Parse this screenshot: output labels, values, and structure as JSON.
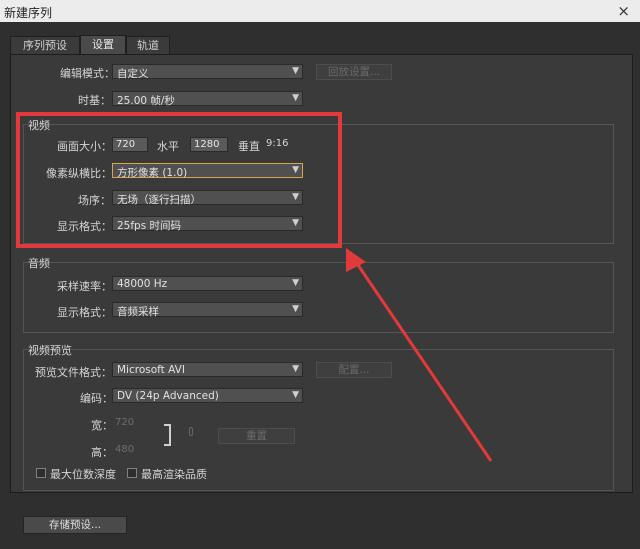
{
  "window": {
    "title": "新建序列",
    "close": "×"
  },
  "tabs": [
    {
      "label": "序列预设"
    },
    {
      "label": "设置"
    },
    {
      "label": "轨道"
    }
  ],
  "edit_mode": {
    "label": "编辑模式：",
    "value": "自定义",
    "button": "回放设置..."
  },
  "timebase": {
    "label": "时基：",
    "value": "25.00 帧/秒"
  },
  "video": {
    "title": "视频",
    "frame_size_label": "画面大小：",
    "width_value": "720",
    "horizontal_label": "水平",
    "height_value": "1280",
    "vertical_label": "垂直",
    "aspect": "9:16",
    "pixel_aspect": {
      "label": "像素纵横比：",
      "value": "方形像素 (1.0)"
    },
    "field": {
      "label": "场序：",
      "value": "无场（逐行扫描）"
    },
    "display_format": {
      "label": "显示格式：",
      "value": "25fps 时间码"
    }
  },
  "audio": {
    "title": "音频",
    "sample_rate": {
      "label": "采样速率：",
      "value": "48000 Hz"
    },
    "display_format": {
      "label": "显示格式：",
      "value": "音频采样"
    }
  },
  "preview": {
    "title": "视频预览",
    "file_format": {
      "label": "预览文件格式：",
      "value": "Microsoft AVI",
      "button": "配置..."
    },
    "codec": {
      "label": "编码：",
      "value": "DV (24p Advanced)"
    },
    "width": {
      "label": "宽：",
      "value": "720"
    },
    "height": {
      "label": "高：",
      "value": "480"
    },
    "reset": "重置",
    "max_depth": "最大位数深度",
    "max_quality": "最高渲染品质"
  },
  "save_preset": "存储预设..."
}
